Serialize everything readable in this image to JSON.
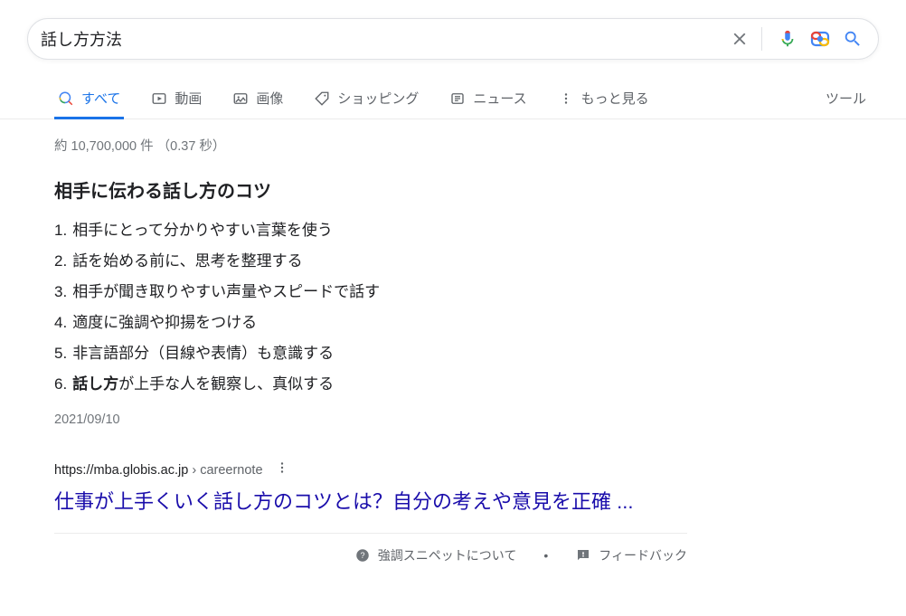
{
  "search": {
    "query": "話し方方法"
  },
  "tabs": {
    "all": "すべて",
    "video": "動画",
    "image": "画像",
    "shopping": "ショッピング",
    "news": "ニュース",
    "more": "もっと見る",
    "tools": "ツール"
  },
  "stats": "約 10,700,000 件 （0.37 秒）",
  "snippet": {
    "title": "相手に伝わる話し方のコツ",
    "items": [
      {
        "n": "1.",
        "text": "相手にとって分かりやすい言葉を使う"
      },
      {
        "n": "2.",
        "text": "話を始める前に、思考を整理する"
      },
      {
        "n": "3.",
        "text": "相手が聞き取りやすい声量やスピードで話す"
      },
      {
        "n": "4.",
        "text": "適度に強調や抑揚をつける"
      },
      {
        "n": "5.",
        "text": "非言語部分（目線や表情）も意識する"
      },
      {
        "n": "6.",
        "bold": "話し方",
        "text": "が上手な人を観察し、真似する"
      }
    ],
    "date": "2021/09/10"
  },
  "result": {
    "cite_domain": "https://mba.globis.ac.jp",
    "cite_path": " › careernote",
    "title": "仕事が上手くいく話し方のコツとは？自分の考えや意見を正確 ..."
  },
  "footer": {
    "about": "強調スニペットについて",
    "feedback": "フィードバック"
  }
}
